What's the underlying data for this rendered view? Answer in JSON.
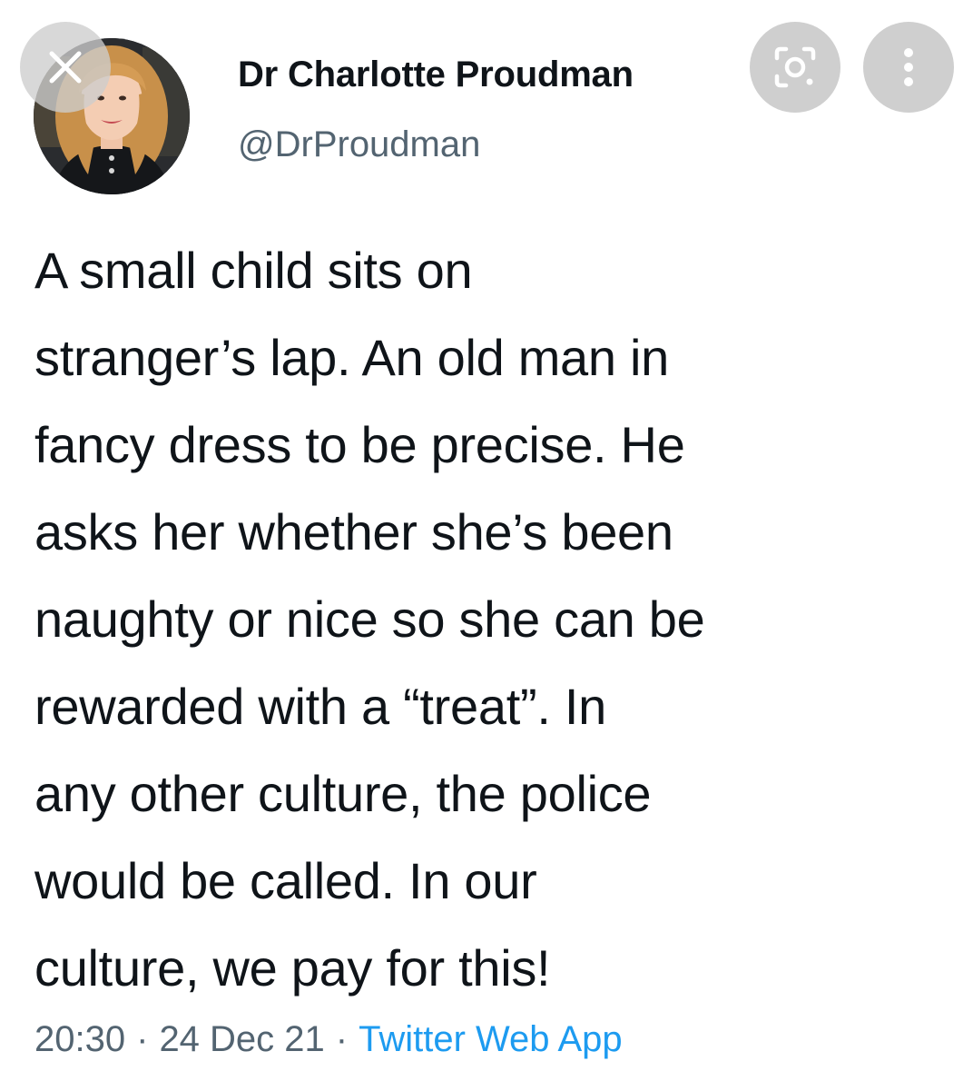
{
  "author": {
    "display_name": "Dr Charlotte Proudman",
    "handle": "@DrProudman"
  },
  "tweet": {
    "text": "A small child sits on\nstranger’s lap. An old man in\nfancy dress to be precise. He\nasks her whether she’s been\nnaughty or nice so she can be\nrewarded with a “treat”. In\nany other culture, the police\nwould be called. In our\nculture, we pay for this!"
  },
  "meta": {
    "time": "20:30",
    "separator": "·",
    "date": "24 Dec 21",
    "source": "Twitter Web App"
  },
  "icons": {
    "close": "close-icon",
    "lens": "lens-icon",
    "more": "more-vertical-icon"
  },
  "colors": {
    "text": "#0f1419",
    "secondary": "#536471",
    "link": "#1d9bf0",
    "button_bg": "#cfcfcf"
  }
}
